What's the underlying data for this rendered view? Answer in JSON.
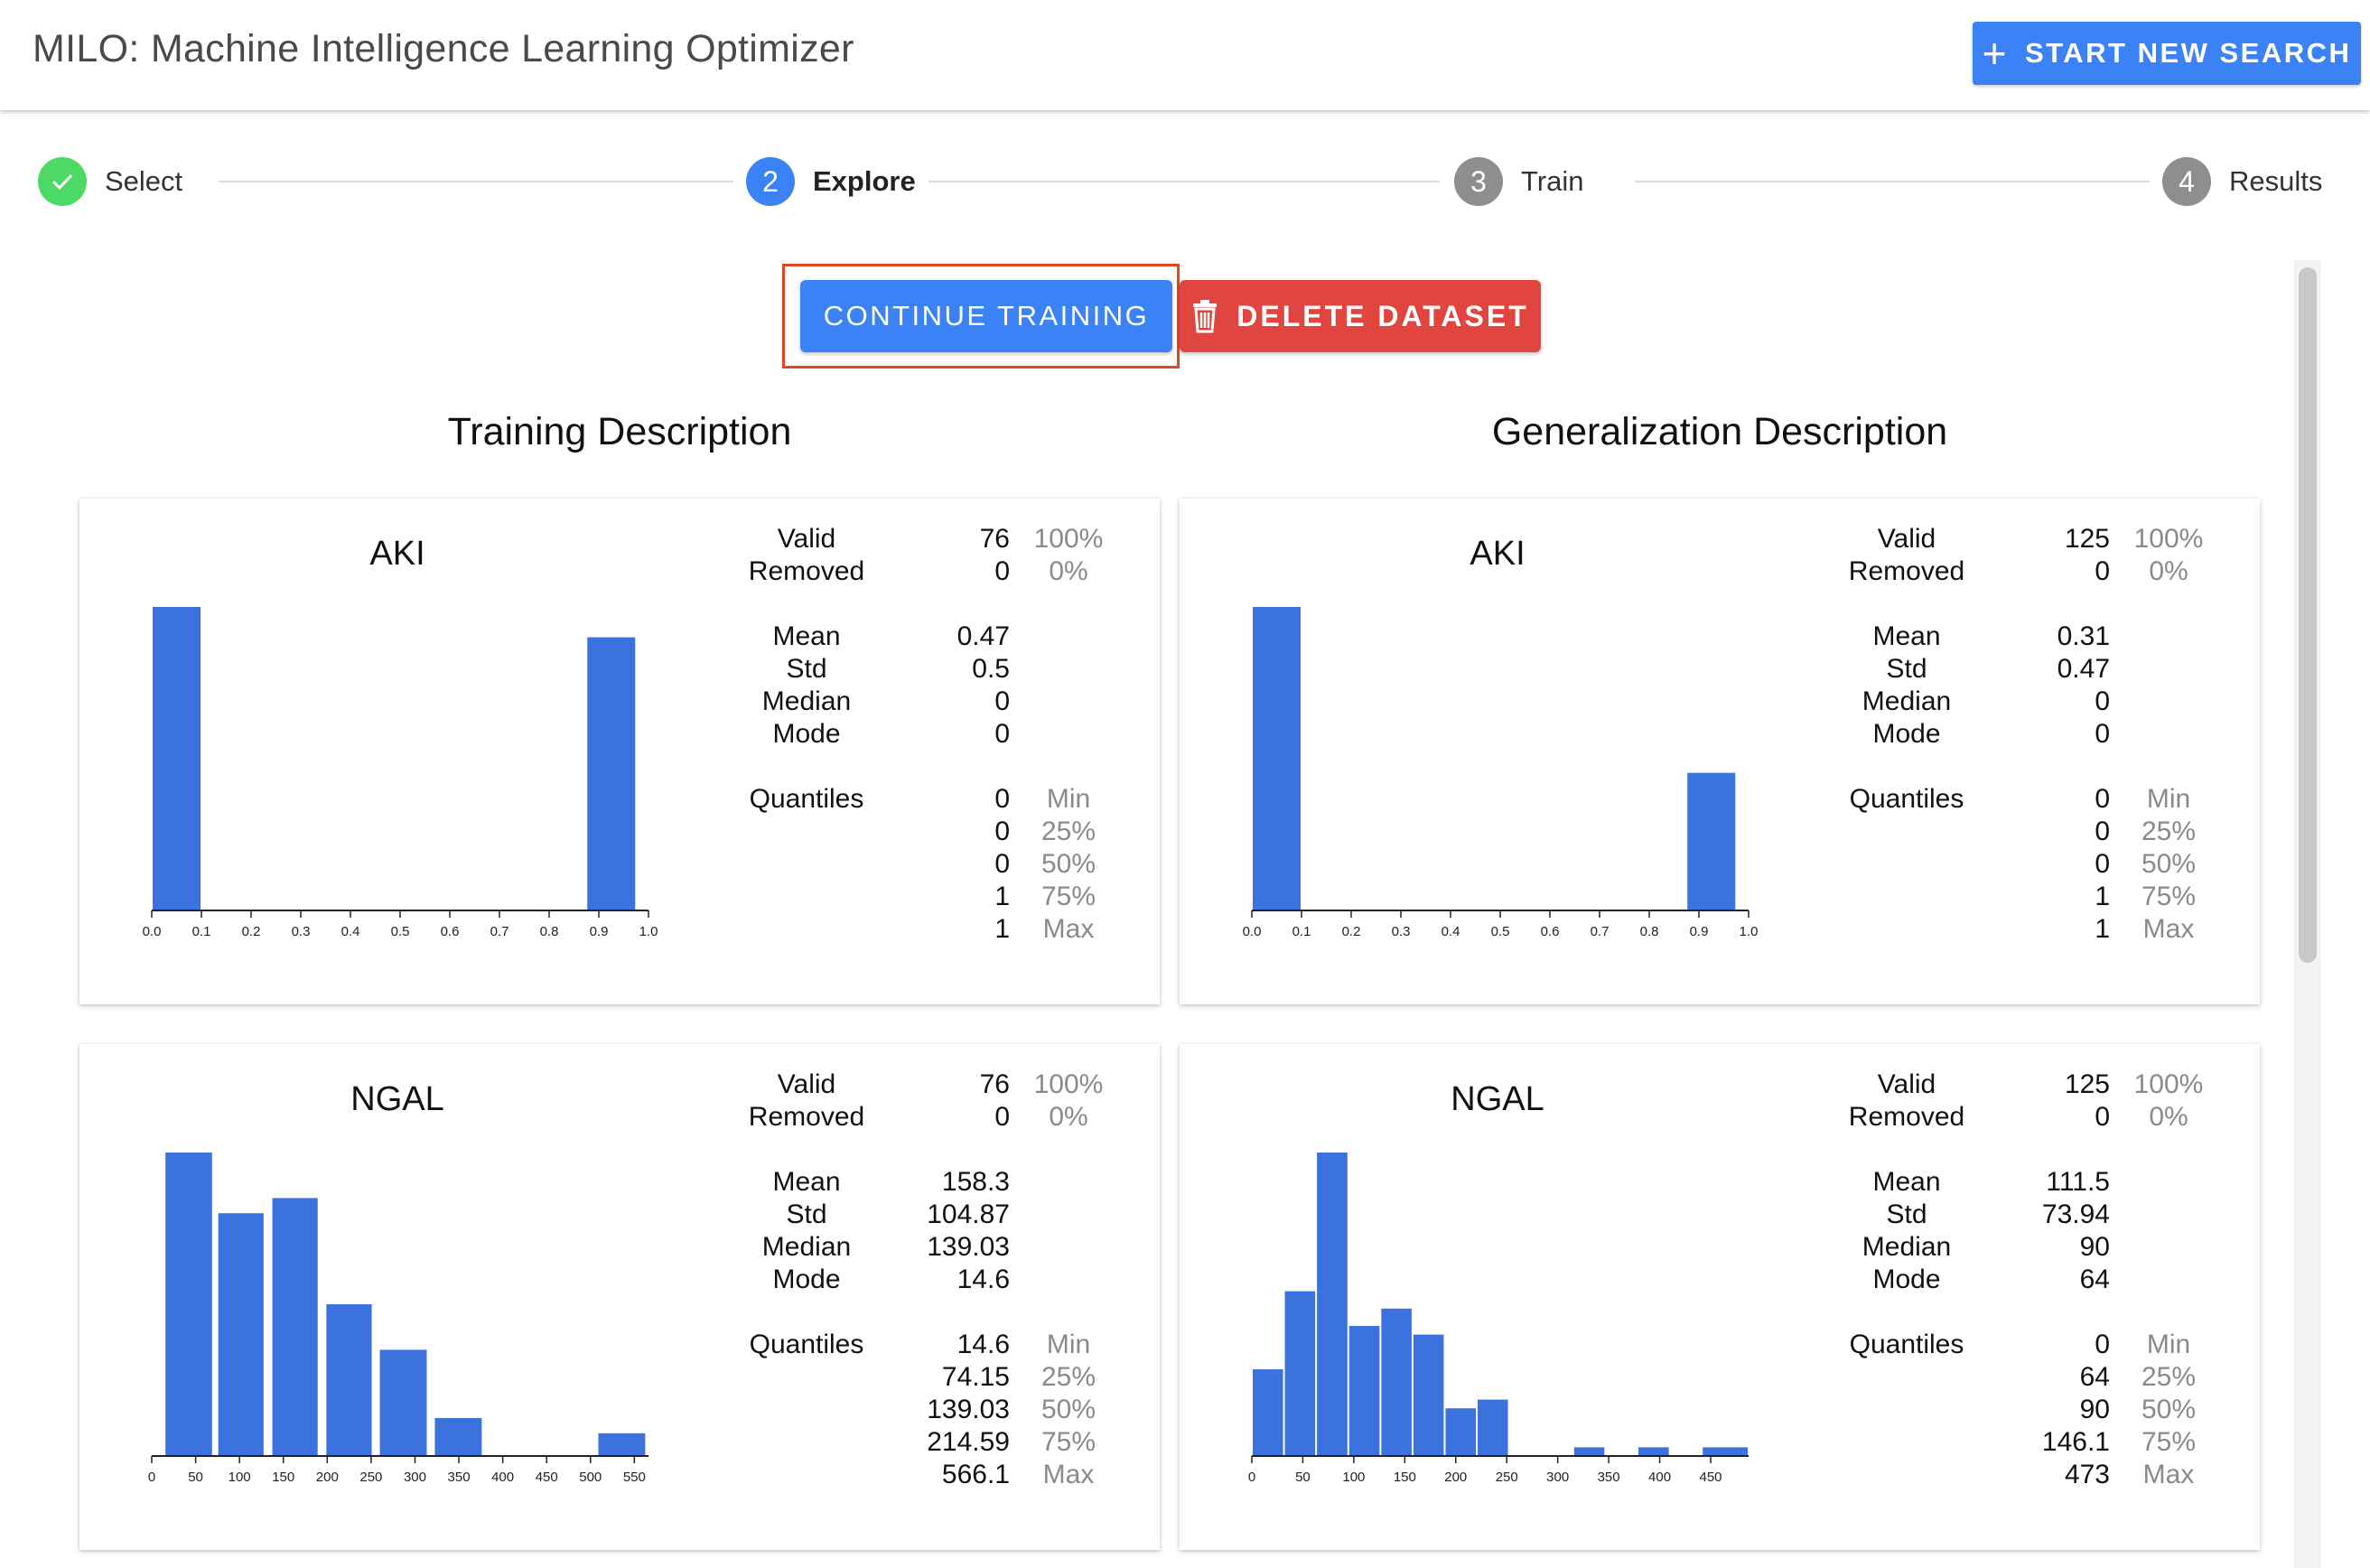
{
  "app": {
    "title": "MILO: Machine Intelligence Learning Optimizer",
    "new_search_label": "START NEW SEARCH"
  },
  "stepper": {
    "steps": [
      {
        "label": "Select",
        "state": "done",
        "number": ""
      },
      {
        "label": "Explore",
        "state": "active",
        "number": "2"
      },
      {
        "label": "Train",
        "state": "pending",
        "number": "3"
      },
      {
        "label": "Results",
        "state": "pending",
        "number": "4"
      }
    ]
  },
  "actions": {
    "continue_label": "CONTINUE TRAINING",
    "delete_label": "DELETE DATASET"
  },
  "colors": {
    "primary": "#3b82f6",
    "danger": "#e0463f",
    "success": "#4cd964",
    "bar": "#3b72de",
    "highlight": "#e1471f"
  },
  "sections": {
    "training_title": "Training Description",
    "generalization_title": "Generalization Description"
  },
  "stat_labels": {
    "valid": "Valid",
    "removed": "Removed",
    "mean": "Mean",
    "std": "Std",
    "median": "Median",
    "mode": "Mode",
    "quantiles": "Quantiles",
    "min": "Min",
    "q25": "25%",
    "q50": "50%",
    "q75": "75%",
    "max": "Max"
  },
  "cards": {
    "train_aki": {
      "name": "AKI",
      "valid": "76",
      "valid_pct": "100%",
      "removed": "0",
      "removed_pct": "0%",
      "mean": "0.47",
      "std": "0.5",
      "median": "0",
      "mode": "0",
      "q_min": "0",
      "q_25": "0",
      "q_50": "0",
      "q_75": "1",
      "q_max": "1"
    },
    "gen_aki": {
      "name": "AKI",
      "valid": "125",
      "valid_pct": "100%",
      "removed": "0",
      "removed_pct": "0%",
      "mean": "0.31",
      "std": "0.47",
      "median": "0",
      "mode": "0",
      "q_min": "0",
      "q_25": "0",
      "q_50": "0",
      "q_75": "1",
      "q_max": "1"
    },
    "train_ngal": {
      "name": "NGAL",
      "valid": "76",
      "valid_pct": "100%",
      "removed": "0",
      "removed_pct": "0%",
      "mean": "158.3",
      "std": "104.87",
      "median": "139.03",
      "mode": "14.6",
      "q_min": "14.6",
      "q_25": "74.15",
      "q_50": "139.03",
      "q_75": "214.59",
      "q_max": "566.1"
    },
    "gen_ngal": {
      "name": "NGAL",
      "valid": "125",
      "valid_pct": "100%",
      "removed": "0",
      "removed_pct": "0%",
      "mean": "111.5",
      "std": "73.94",
      "median": "90",
      "mode": "64",
      "q_min": "0",
      "q_25": "64",
      "q_50": "90",
      "q_75": "146.1",
      "q_max": "473"
    }
  },
  "chart_data": [
    {
      "id": "train_aki",
      "type": "bar",
      "title": "AKI",
      "xlim": [
        0,
        1.0
      ],
      "ticks": [
        "0.0",
        "0.1",
        "0.2",
        "0.3",
        "0.4",
        "0.5",
        "0.6",
        "0.7",
        "0.8",
        "0.9",
        "1.0"
      ],
      "bins": [
        {
          "x0": 0.0,
          "x1": 0.1,
          "value": 40
        },
        {
          "x0": 0.875,
          "x1": 0.975,
          "value": 36
        }
      ]
    },
    {
      "id": "gen_aki",
      "type": "bar",
      "title": "AKI",
      "xlim": [
        0,
        1.0
      ],
      "ticks": [
        "0.0",
        "0.1",
        "0.2",
        "0.3",
        "0.4",
        "0.5",
        "0.6",
        "0.7",
        "0.8",
        "0.9",
        "1.0"
      ],
      "bins": [
        {
          "x0": 0.0,
          "x1": 0.1,
          "value": 86
        },
        {
          "x0": 0.875,
          "x1": 0.975,
          "value": 39
        }
      ]
    },
    {
      "id": "train_ngal",
      "type": "bar",
      "title": "NGAL",
      "xlim": [
        0,
        566.1
      ],
      "ticks": [
        "0",
        "50",
        "100",
        "150",
        "200",
        "250",
        "300",
        "350",
        "400",
        "450",
        "500",
        "550"
      ],
      "bins": [
        {
          "x0": 14.6,
          "x1": 69.75,
          "value": 20
        },
        {
          "x0": 74.8,
          "x1": 128.5,
          "value": 16
        },
        {
          "x0": 136.4,
          "x1": 190.1,
          "value": 17
        },
        {
          "x0": 198.0,
          "x1": 251.7,
          "value": 10
        },
        {
          "x0": 258.9,
          "x1": 314.4,
          "value": 7
        },
        {
          "x0": 321.6,
          "x1": 377.1,
          "value": 2.5
        },
        {
          "x0": 507.9,
          "x1": 563.4,
          "value": 1.5
        }
      ]
    },
    {
      "id": "gen_ngal",
      "type": "bar",
      "title": "NGAL",
      "xlim": [
        0,
        487.2
      ],
      "ticks": [
        "0",
        "50",
        "100",
        "150",
        "200",
        "250",
        "300",
        "350",
        "400",
        "450"
      ],
      "bins": [
        {
          "x0": 0,
          "x1": 31.5,
          "value": 10
        },
        {
          "x0": 31.5,
          "x1": 63.0,
          "value": 19
        },
        {
          "x0": 63.0,
          "x1": 94.6,
          "value": 35
        },
        {
          "x0": 94.6,
          "x1": 126.1,
          "value": 15
        },
        {
          "x0": 126.1,
          "x1": 157.6,
          "value": 17
        },
        {
          "x0": 157.6,
          "x1": 189.1,
          "value": 14
        },
        {
          "x0": 189.1,
          "x1": 220.6,
          "value": 5.5
        },
        {
          "x0": 220.6,
          "x1": 252.1,
          "value": 6.5
        },
        {
          "x0": 315.2,
          "x1": 346.7,
          "value": 1
        },
        {
          "x0": 378.3,
          "x1": 409.8,
          "value": 1
        },
        {
          "x0": 441.3,
          "x1": 487.2,
          "value": 1
        }
      ]
    }
  ]
}
